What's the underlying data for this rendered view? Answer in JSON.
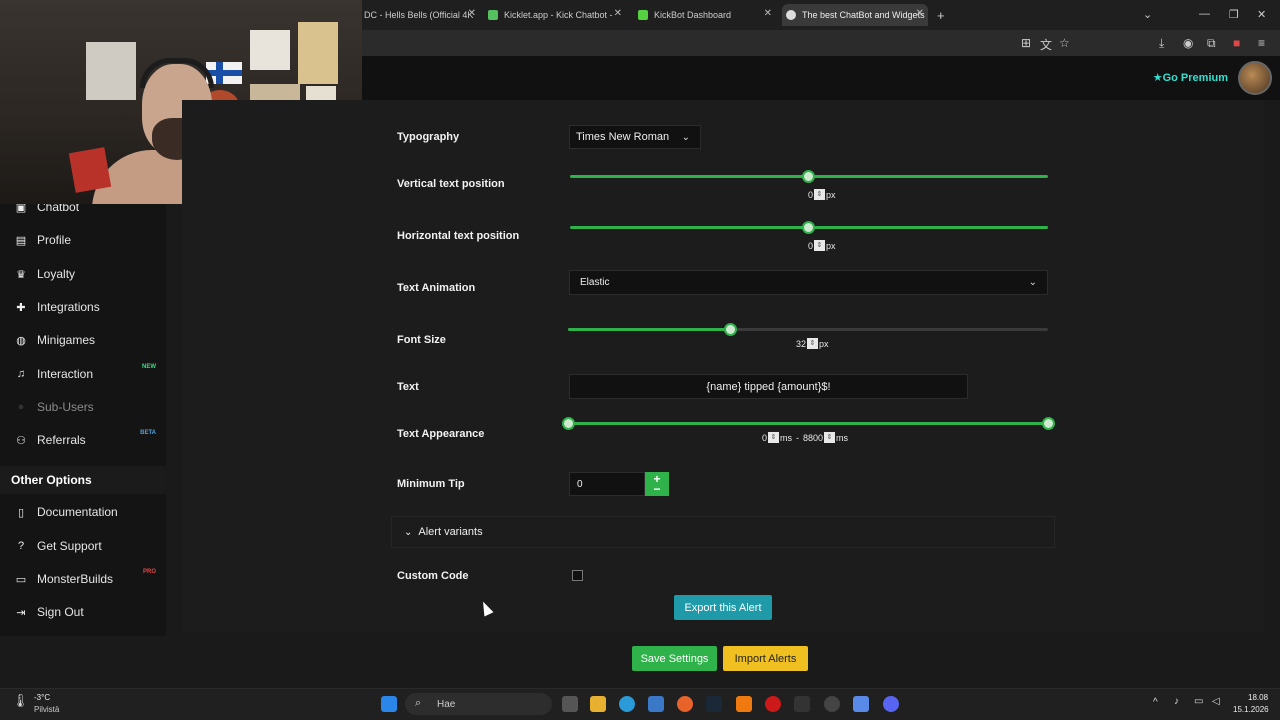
{
  "browser": {
    "tabs": [
      {
        "title": "DC - Hells Bells (Official 4K"
      },
      {
        "title": "Kicklet.app - Kick Chatbot -"
      },
      {
        "title": "KickBot Dashboard"
      },
      {
        "title": "The best ChatBot and Widgets"
      }
    ],
    "new_tab": "+"
  },
  "header": {
    "premium_label": "Go Premium"
  },
  "sidebar": {
    "items": [
      {
        "label": "Chatbot",
        "icon": "robot-icon"
      },
      {
        "label": "Profile",
        "icon": "user-icon"
      },
      {
        "label": "Loyalty",
        "icon": "trophy-icon"
      },
      {
        "label": "Integrations",
        "icon": "puzzle-icon"
      },
      {
        "label": "Minigames",
        "icon": "gamepad-icon"
      },
      {
        "label": "Interaction",
        "icon": "music-icon",
        "badge": "NEW"
      },
      {
        "label": "Sub-Users",
        "icon": "users-icon"
      },
      {
        "label": "Referrals",
        "icon": "users-icon",
        "badge": "BETA"
      }
    ],
    "other_title": "Other Options",
    "other_items": [
      {
        "label": "Documentation",
        "icon": "book-icon"
      },
      {
        "label": "Get Support",
        "icon": "question-icon"
      },
      {
        "label": "MonsterBuilds",
        "icon": "monitor-icon",
        "badge": "PRO"
      },
      {
        "label": "Sign Out",
        "icon": "sign-out-icon"
      }
    ]
  },
  "form": {
    "typography": {
      "label": "Typography",
      "value": "Times New Roman"
    },
    "vertical": {
      "label": "Vertical text position",
      "value": "0",
      "unit": "px",
      "fraction": 0.5
    },
    "horizontal": {
      "label": "Horizontal text position",
      "value": "0",
      "unit": "px",
      "fraction": 0.5
    },
    "animation": {
      "label": "Text Animation",
      "value": "Elastic"
    },
    "font_size": {
      "label": "Font Size",
      "value": "32",
      "unit": "px",
      "fraction": 0.34
    },
    "text": {
      "label": "Text",
      "value": "{name} tipped {amount}$!"
    },
    "appearance": {
      "label": "Text Appearance",
      "from": "0",
      "to": "8800",
      "unit": "ms",
      "separator": "-"
    },
    "min_tip": {
      "label": "Minimum Tip",
      "value": "0"
    },
    "variants_label": "Alert variants",
    "custom_code_label": "Custom Code",
    "custom_code_checked": false
  },
  "buttons": {
    "export": "Export this Alert",
    "save": "Save Settings",
    "import": "Import Alerts"
  },
  "taskbar": {
    "weather_temp": "-3°C",
    "weather_desc": "Pilvistä",
    "search_placeholder": "Hae",
    "time": "18.08",
    "date": "15.1.2026"
  },
  "colors": {
    "accent_green": "#2fb24a",
    "premium": "#33e0d0",
    "export_btn": "#1f9aa8",
    "import_btn": "#f0c020",
    "badge_new": "#3ddc84",
    "badge_beta": "#4aa3df",
    "badge_pro": "#e04848"
  }
}
